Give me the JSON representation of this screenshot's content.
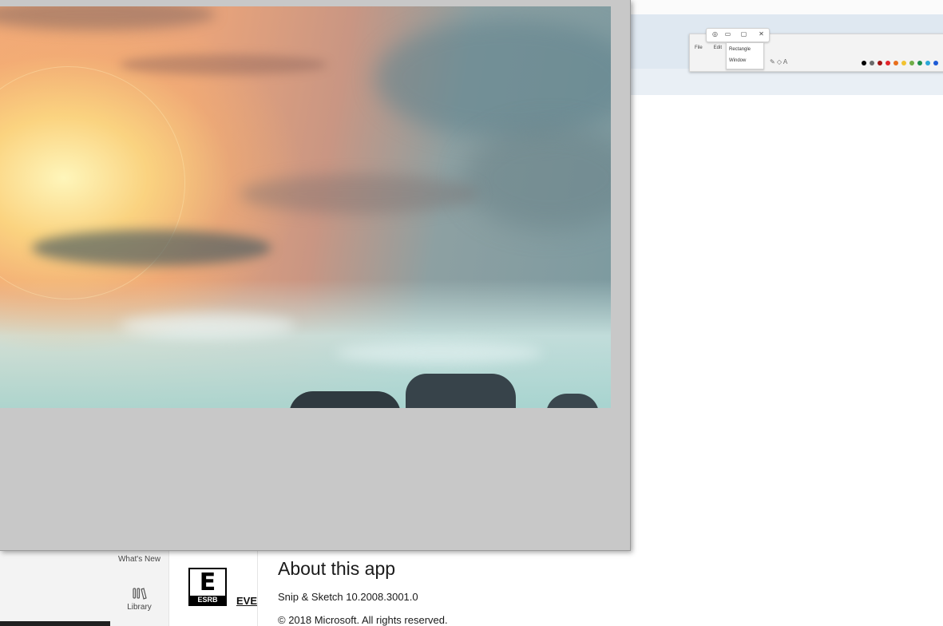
{
  "store_page": {
    "sidebar": [
      {
        "label": "What's New",
        "icon": "whats-new-icon"
      },
      {
        "label": "Library",
        "icon": "library-icon"
      }
    ],
    "esrb": {
      "rating_letter": "E",
      "label": "ESRB",
      "link_text": "EVEI"
    },
    "about": {
      "title": "About this app",
      "version": "Snip & Sketch 10.2008.3001.0",
      "copyright": "© 2018 Microsoft. All rights reserved."
    },
    "screenshot_thumbnail": {
      "menu": [
        "File",
        "Edit"
      ],
      "dropdown_items": [
        "Rectangle",
        "Window"
      ],
      "palette": [
        "#000000",
        "#6b6b6b",
        "#a31515",
        "#e3242b",
        "#e86f1c",
        "#f2c230",
        "#70ad47",
        "#1f8f4e",
        "#2aa7d8",
        "#1e5bd6"
      ]
    }
  },
  "snip_window": {
    "image": "sky-sunset-landscape"
  },
  "colors": {
    "window_bg": "#c8c8c8",
    "sidebar_bg": "#f3f3f3"
  }
}
